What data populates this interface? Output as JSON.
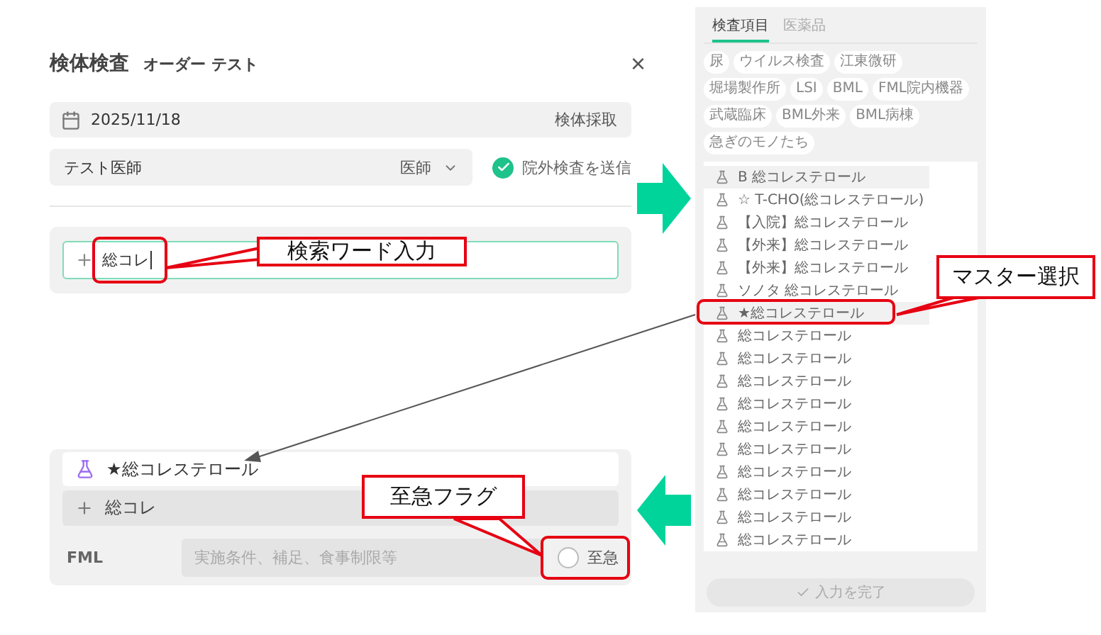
{
  "dialog": {
    "title": "検体検査",
    "subtitle": "オーダー テスト",
    "close": "×",
    "date": "2025/11/18",
    "date_action": "検体採取",
    "doctor": "テスト医師",
    "role": "医師",
    "send_external": {
      "label": "院外検査を送信",
      "checked": true
    },
    "search_value": "総コレ"
  },
  "order": {
    "item": "★総コレステロール",
    "search_value": "総コレ",
    "lab_label": "FML",
    "note_placeholder": "実施条件、補足、食事制限等",
    "urgent": {
      "label": "至急",
      "checked": false
    }
  },
  "picker": {
    "tabs": [
      {
        "label": "検査項目",
        "selected": true
      },
      {
        "label": "医薬品",
        "selected": false
      }
    ],
    "chips": [
      "尿",
      "ウイルス検査",
      "江東微研",
      "堀場製作所",
      "LSI",
      "BML",
      "FML院内機器",
      "武蔵臨床",
      "BML外来",
      "BML病棟",
      "急ぎのモノたち"
    ],
    "items": [
      {
        "label": "B 総コレステロール",
        "selected": true
      },
      {
        "label": "☆ T-CHO(総コレステロール)",
        "selected": false
      },
      {
        "label": "【入院】総コレステロール",
        "selected": false
      },
      {
        "label": "【外来】総コレステロール",
        "selected": false
      },
      {
        "label": "【外来】総コレステロール",
        "selected": false
      },
      {
        "label": "ソノタ 総コレステロール",
        "selected": false
      },
      {
        "label": "★総コレステロール",
        "selected": true
      },
      {
        "label": "総コレステロール",
        "selected": false
      },
      {
        "label": "総コレステロール",
        "selected": false
      },
      {
        "label": "総コレステロール",
        "selected": false
      },
      {
        "label": "総コレステロール",
        "selected": false
      },
      {
        "label": "総コレステロール",
        "selected": false
      },
      {
        "label": "総コレステロール",
        "selected": false
      },
      {
        "label": "総コレステロール",
        "selected": false
      },
      {
        "label": "総コレステロール",
        "selected": false
      },
      {
        "label": "総コレステロール",
        "selected": false
      },
      {
        "label": "総コレステロール",
        "selected": false
      }
    ],
    "done_button": {
      "label": "入力を完了",
      "disabled": true
    }
  },
  "annotations": [
    "検索ワード入力",
    "マスター選択",
    "至急フラグ"
  ]
}
